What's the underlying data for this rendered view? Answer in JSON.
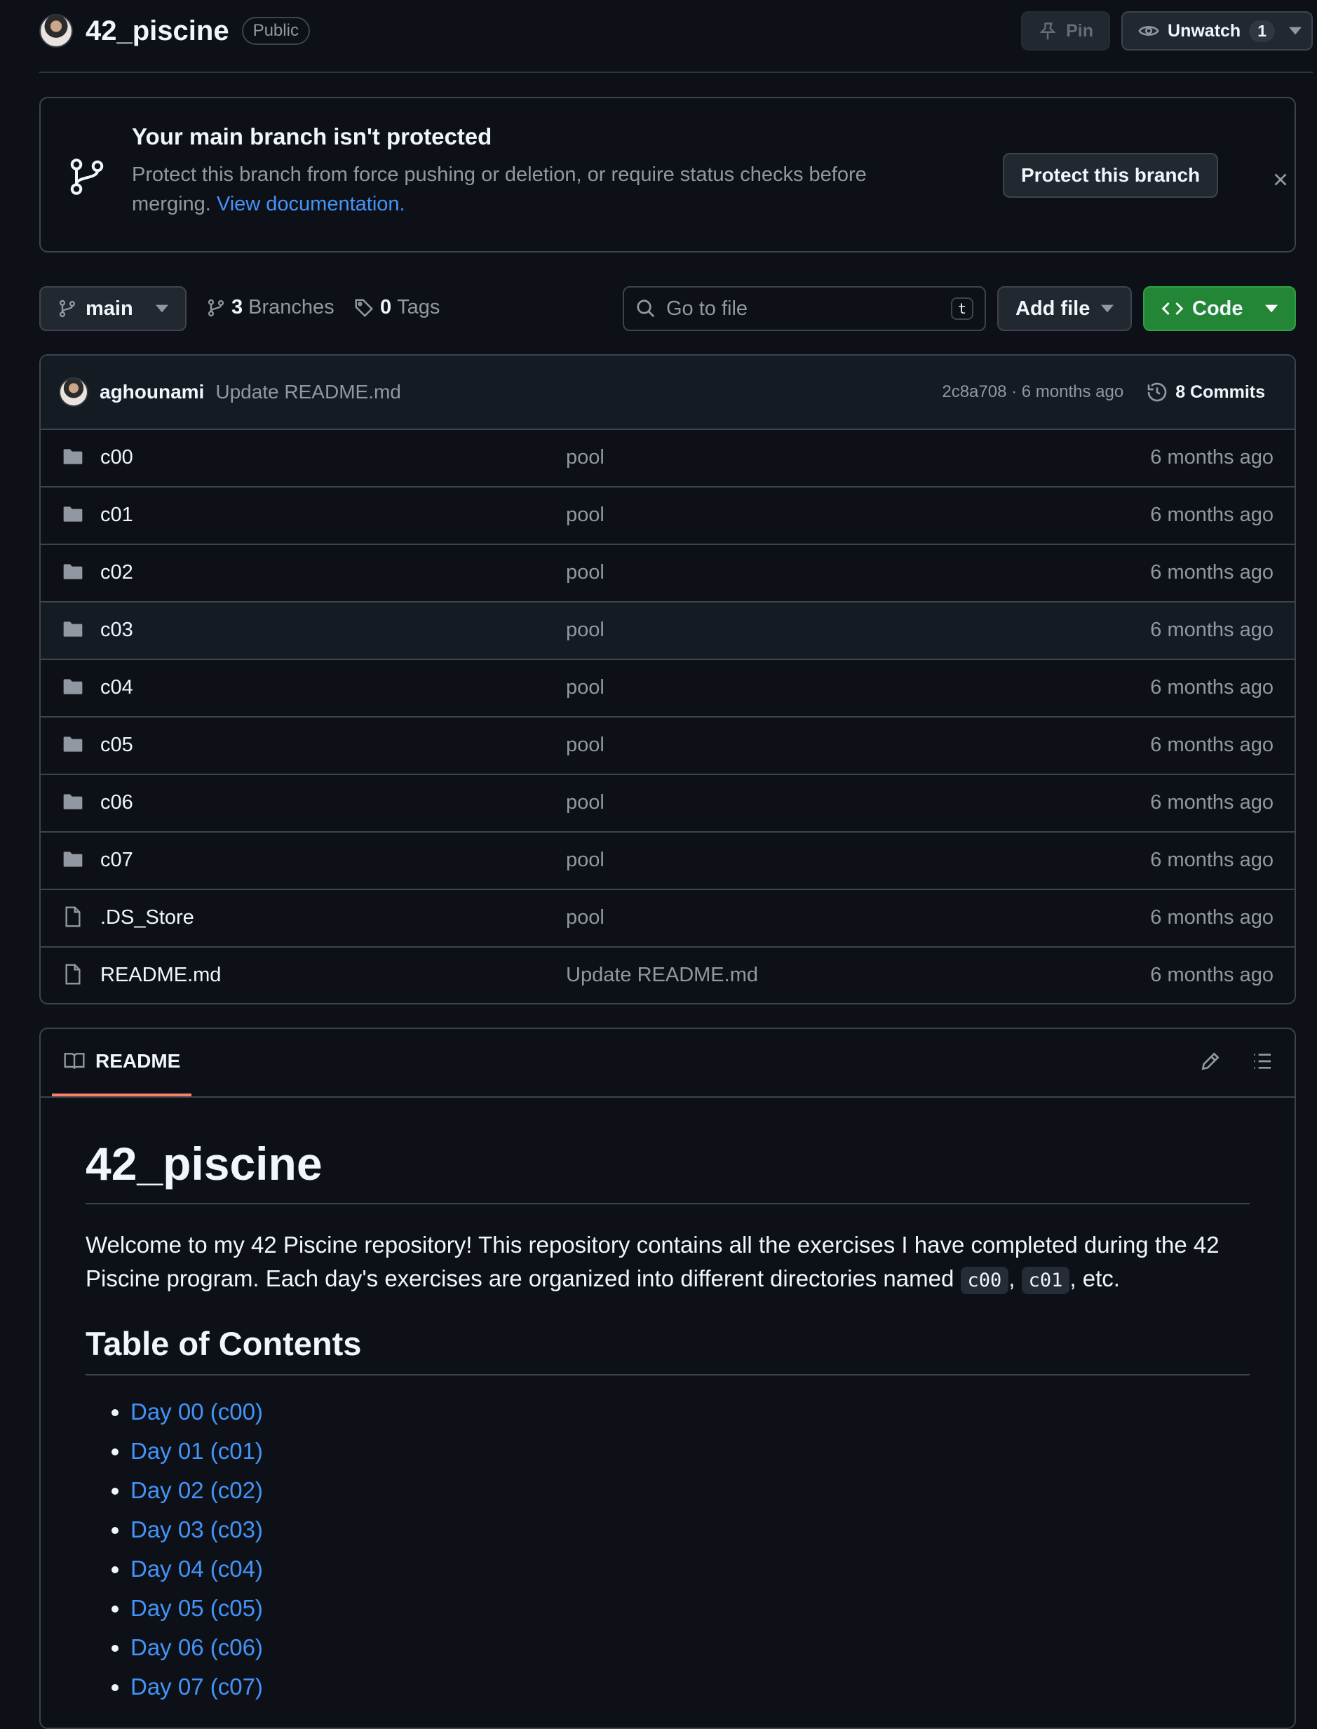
{
  "repo": {
    "name": "42_piscine",
    "visibility": "Public"
  },
  "header_actions": {
    "pin_label": "Pin",
    "watch_label": "Unwatch",
    "watch_count": "1"
  },
  "banner": {
    "title": "Your main branch isn't protected",
    "text": "Protect this branch from force pushing or deletion, or require status checks before merging.",
    "link": "View documentation.",
    "button": "Protect this branch"
  },
  "toolbar": {
    "branch": "main",
    "branches_count": "3",
    "branches_label": "Branches",
    "tags_count": "0",
    "tags_label": "Tags",
    "search_placeholder": "Go to file",
    "search_shortcut": "t",
    "add_file_label": "Add file",
    "code_label": "Code"
  },
  "latest_commit": {
    "author": "aghounami",
    "message": "Update README.md",
    "meta": "2c8a708 · 6 months ago",
    "commits_label": "8 Commits"
  },
  "files": [
    {
      "type": "folder",
      "name": "c00",
      "message": "pool",
      "age": "6 months ago"
    },
    {
      "type": "folder",
      "name": "c01",
      "message": "pool",
      "age": "6 months ago"
    },
    {
      "type": "folder",
      "name": "c02",
      "message": "pool",
      "age": "6 months ago"
    },
    {
      "type": "folder",
      "name": "c03",
      "message": "pool",
      "age": "6 months ago"
    },
    {
      "type": "folder",
      "name": "c04",
      "message": "pool",
      "age": "6 months ago"
    },
    {
      "type": "folder",
      "name": "c05",
      "message": "pool",
      "age": "6 months ago"
    },
    {
      "type": "folder",
      "name": "c06",
      "message": "pool",
      "age": "6 months ago"
    },
    {
      "type": "folder",
      "name": "c07",
      "message": "pool",
      "age": "6 months ago"
    },
    {
      "type": "file",
      "name": ".DS_Store",
      "message": "pool",
      "age": "6 months ago"
    },
    {
      "type": "file",
      "name": "README.md",
      "message": "Update README.md",
      "age": "6 months ago"
    }
  ],
  "readme": {
    "tab_label": "README",
    "title": "42_piscine",
    "intro_before": "Welcome to my 42 Piscine repository! This repository contains all the exercises I have completed during the 42 Piscine program. Each day's exercises are organized into different directories named",
    "code1": "c00",
    "sep": ",",
    "code2": "c01",
    "intro_after": ", etc.",
    "toc_title": "Table of Contents",
    "toc": [
      "Day 00 (c00)",
      "Day 01 (c01)",
      "Day 02 (c02)",
      "Day 03 (c03)",
      "Day 04 (c04)",
      "Day 05 (c05)",
      "Day 06 (c06)",
      "Day 07 (c07)"
    ]
  },
  "colors": {
    "background": "#0d1117",
    "border": "#3d444d",
    "link": "#4493f8",
    "primary_button": "#238636",
    "tab_underline": "#f78166"
  }
}
